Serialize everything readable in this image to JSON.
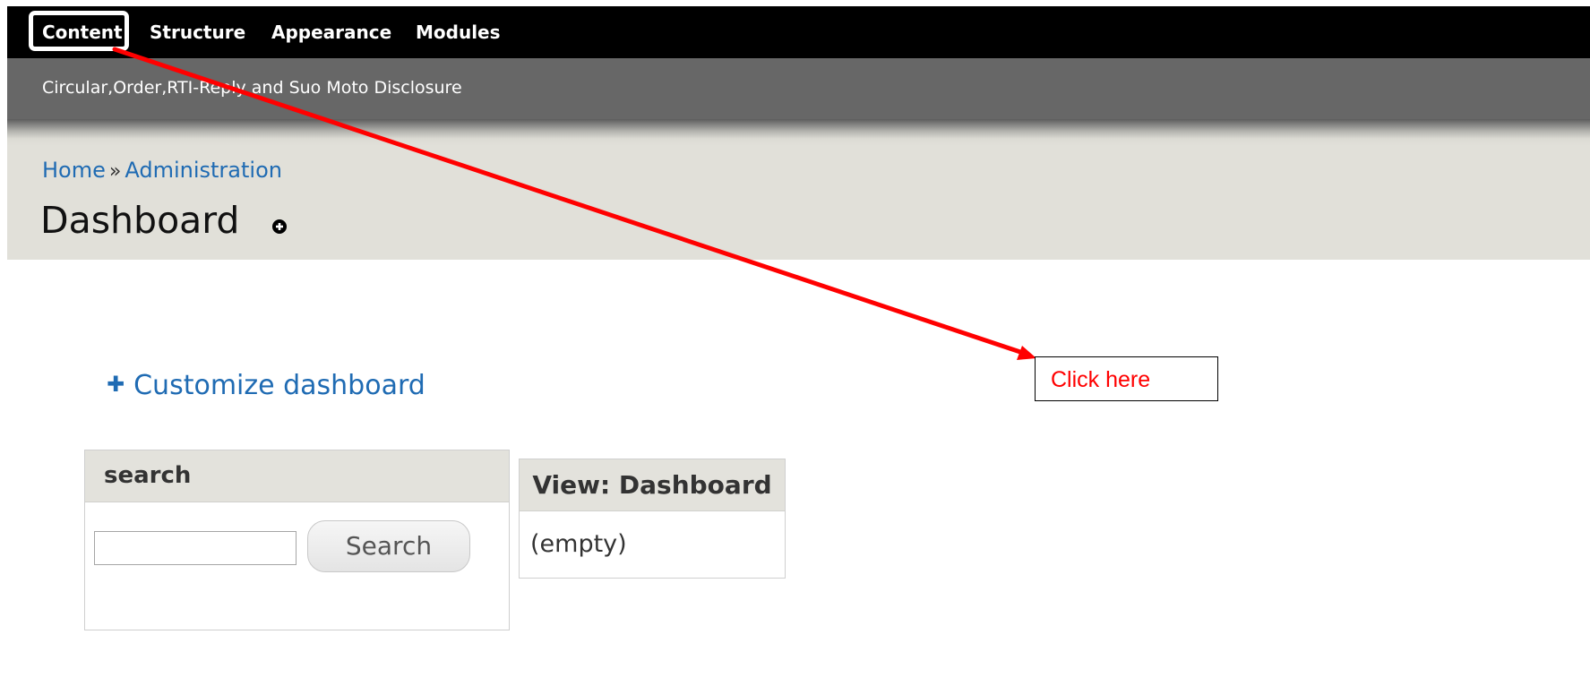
{
  "toolbar": {
    "items": [
      "Content",
      "Structure",
      "Appearance",
      "Modules"
    ]
  },
  "shortcuts": {
    "item": "Circular,Order,RTI-Reply and Suo Moto Disclosure"
  },
  "breadcrumb": {
    "home": "Home",
    "separator": "»",
    "admin": "Administration"
  },
  "page": {
    "title": "Dashboard"
  },
  "dashboard": {
    "customize_label": "Customize dashboard",
    "search_block": {
      "title": "search",
      "input_value": "",
      "button_label": "Search"
    },
    "view_block": {
      "title": "View: Dashboard",
      "body": "(empty)"
    }
  },
  "annotation": {
    "callout_text": "Click here",
    "color": "#ff0000"
  },
  "icons": {
    "shortcut": "add-shortcut-icon",
    "customize": "plus-icon"
  }
}
